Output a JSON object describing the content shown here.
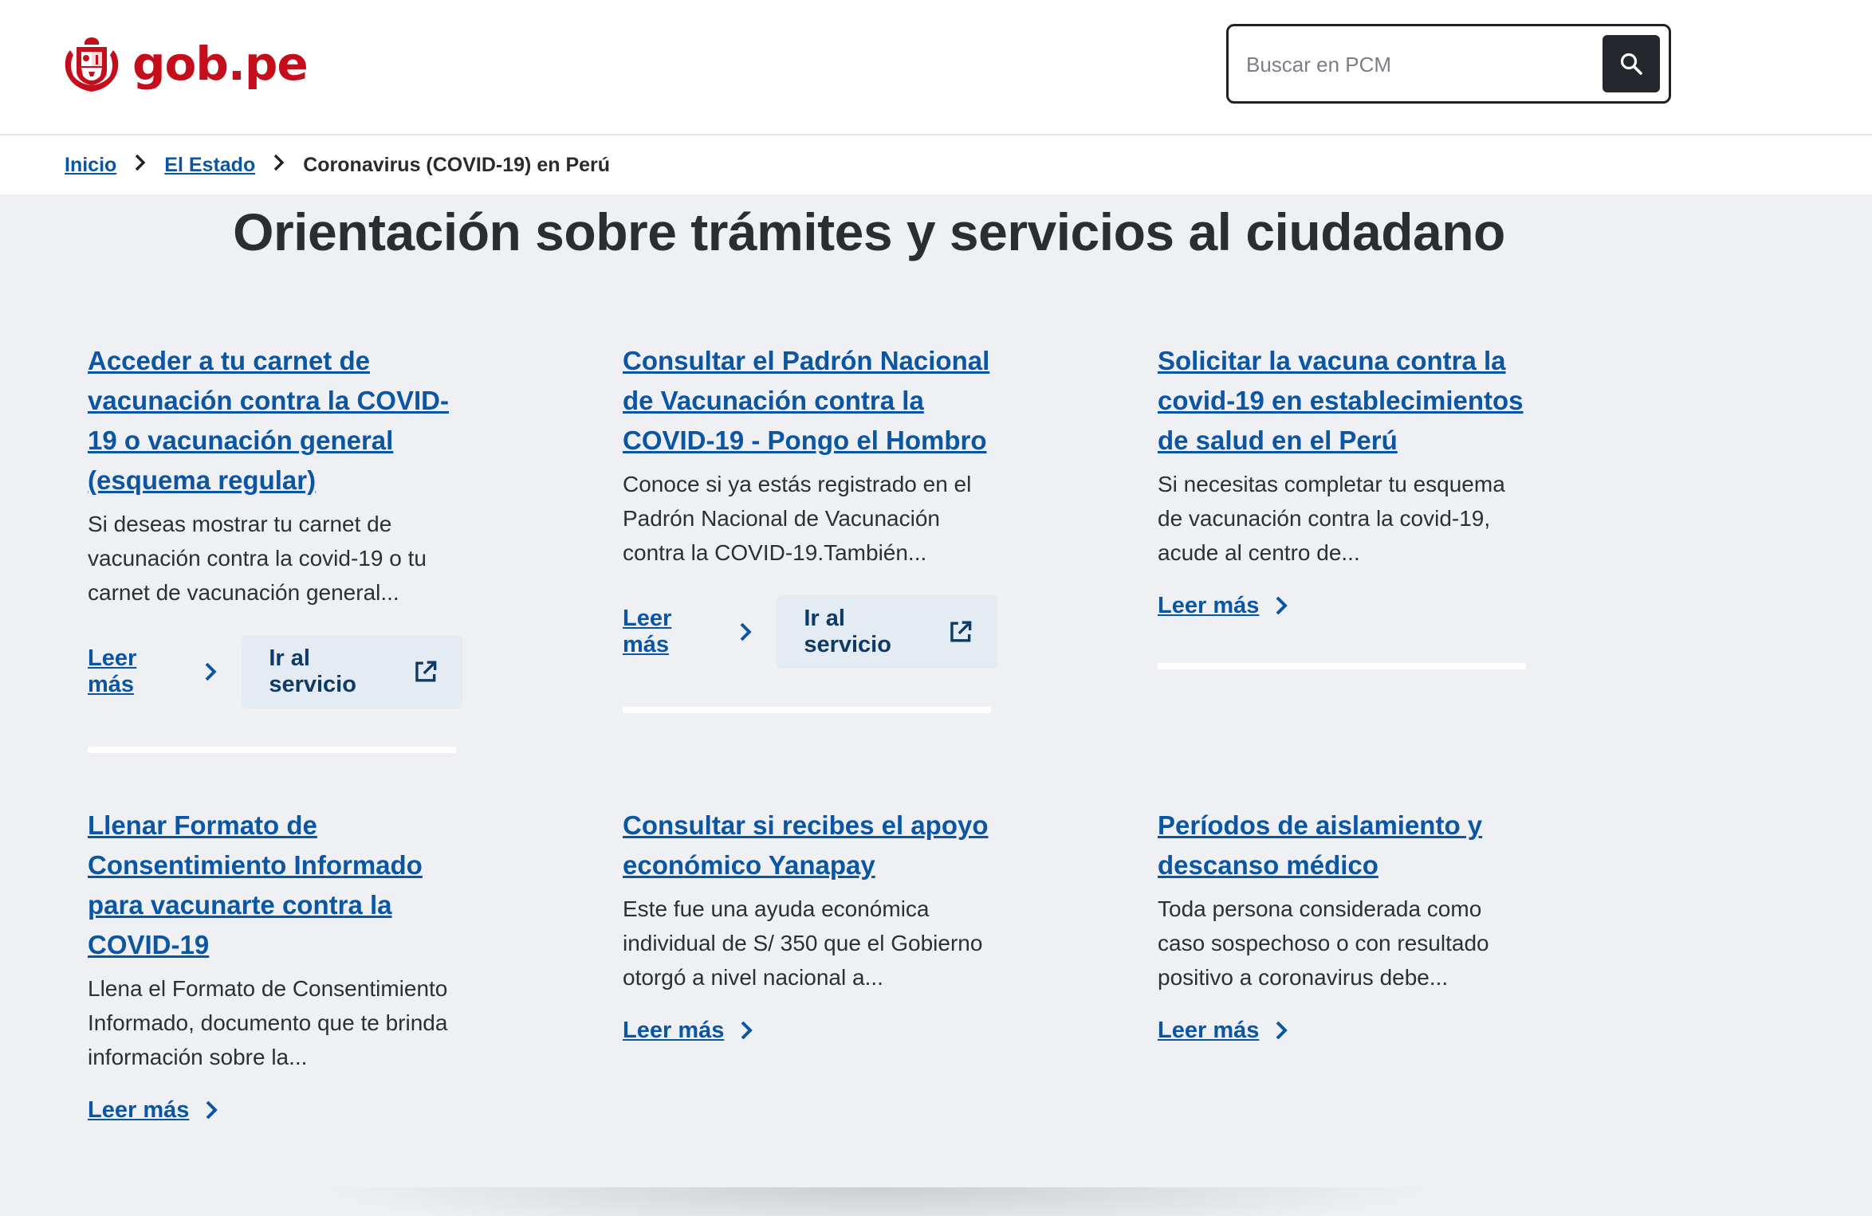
{
  "header": {
    "logo_text": "gob.pe",
    "search": {
      "placeholder": "Buscar en PCM"
    }
  },
  "breadcrumb": {
    "items": [
      "Inicio",
      "El Estado"
    ],
    "current": "Coronavirus (COVID-19) en Perú"
  },
  "main": {
    "title": "Orientación sobre trámites y servicios al ciudadano",
    "cards": [
      {
        "title": "Acceder a tu carnet de vacunación contra la COVID-19 o vacunación general (esquema regular)",
        "description": "Si deseas mostrar tu carnet de vacunación contra la covid-19 o tu carnet de vacunación general...",
        "read_more": "Leer más",
        "service": "Ir al servicio"
      },
      {
        "title": "Consultar el Padrón Nacional de Vacunación contra la COVID-19 - Pongo el Hombro",
        "description": "Conoce si ya estás registrado en el Padrón Nacional de Vacunación contra la COVID-19.También...",
        "read_more": "Leer más",
        "service": "Ir al servicio"
      },
      {
        "title": "Solicitar la vacuna contra la covid-19 en establecimientos de salud en el Perú",
        "description": "Si necesitas completar tu esquema de vacunación contra la covid-19, acude al centro de...",
        "read_more": "Leer más"
      },
      {
        "title": "Llenar Formato de Consentimiento Informado para vacunarte contra la COVID-19",
        "description": "Llena el Formato de Consentimiento Informado, documento que te brinda información sobre la...",
        "read_more": "Leer más"
      },
      {
        "title": "Consultar si recibes el apoyo económico Yanapay",
        "description": "Este fue una ayuda económica individual de S/ 350 que el Gobierno otorgó a nivel nacional a...",
        "read_more": "Leer más"
      },
      {
        "title": "Períodos de aislamiento y descanso médico",
        "description": "Toda persona considerada como caso sospechoso o con resultado positivo a coronavirus debe...",
        "read_more": "Leer más"
      }
    ]
  },
  "colors": {
    "brand_red": "#c40e1b",
    "link_blue": "#0b56a4",
    "background": "#eef0f4"
  }
}
